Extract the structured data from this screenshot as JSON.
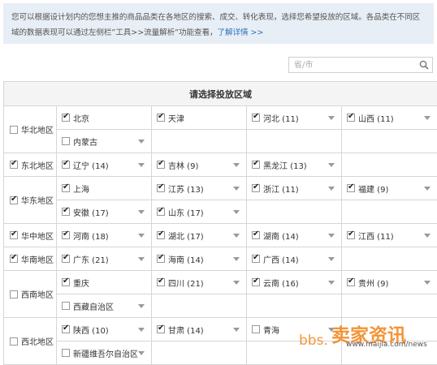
{
  "notice": {
    "text": "您可以根据设计划内的您想主推的商品品类在各地区的搜索、成交、转化表现，选择您希望投放的区域。各品类在不同区域的数据表现可以通过左侧栏”工具>>流量解析”功能查看，",
    "link": "了解详情 >>"
  },
  "search": {
    "placeholder": "省/市",
    "icon": "search-icon"
  },
  "table": {
    "header": "请选择投放区域",
    "regions": [
      {
        "label": "华北地区",
        "checked": false,
        "rows": [
          [
            {
              "label": "北京",
              "checked": true,
              "arrow": false
            },
            {
              "label": "天津",
              "checked": true,
              "arrow": false
            },
            {
              "label": "河北 (11)",
              "checked": true,
              "arrow": true
            },
            {
              "label": "山西 (11)",
              "checked": true,
              "arrow": true
            }
          ],
          [
            {
              "label": "内蒙古",
              "checked": false,
              "arrow": true
            }
          ]
        ]
      },
      {
        "label": "东北地区",
        "checked": true,
        "rows": [
          [
            {
              "label": "辽宁 (14)",
              "checked": true,
              "arrow": true
            },
            {
              "label": "吉林 (9)",
              "checked": true,
              "arrow": true
            },
            {
              "label": "黑龙江 (13)",
              "checked": true,
              "arrow": true
            }
          ]
        ]
      },
      {
        "label": "华东地区",
        "checked": true,
        "rows": [
          [
            {
              "label": "上海",
              "checked": true,
              "arrow": false
            },
            {
              "label": "江苏 (13)",
              "checked": true,
              "arrow": true
            },
            {
              "label": "浙江 (11)",
              "checked": true,
              "arrow": true
            },
            {
              "label": "福建 (9)",
              "checked": true,
              "arrow": true
            }
          ],
          [
            {
              "label": "安徽 (17)",
              "checked": true,
              "arrow": true
            },
            {
              "label": "山东 (17)",
              "checked": true,
              "arrow": true
            }
          ]
        ]
      },
      {
        "label": "华中地区",
        "checked": true,
        "rows": [
          [
            {
              "label": "河南 (18)",
              "checked": true,
              "arrow": true
            },
            {
              "label": "湖北 (17)",
              "checked": true,
              "arrow": true
            },
            {
              "label": "湖南 (14)",
              "checked": true,
              "arrow": true
            },
            {
              "label": "江西 (11)",
              "checked": true,
              "arrow": true
            }
          ]
        ]
      },
      {
        "label": "华南地区",
        "checked": true,
        "rows": [
          [
            {
              "label": "广东 (21)",
              "checked": true,
              "arrow": true
            },
            {
              "label": "海南 (14)",
              "checked": true,
              "arrow": true
            },
            {
              "label": "广西 (14)",
              "checked": true,
              "arrow": true
            }
          ]
        ]
      },
      {
        "label": "西南地区",
        "checked": false,
        "rows": [
          [
            {
              "label": "重庆",
              "checked": true,
              "arrow": false
            },
            {
              "label": "四川 (21)",
              "checked": true,
              "arrow": true
            },
            {
              "label": "云南 (16)",
              "checked": true,
              "arrow": true
            },
            {
              "label": "贵州 (9)",
              "checked": true,
              "arrow": true
            }
          ],
          [
            {
              "label": "西藏自治区",
              "checked": false,
              "arrow": true
            }
          ]
        ]
      },
      {
        "label": "西北地区",
        "checked": false,
        "rows": [
          [
            {
              "label": "陕西 (10)",
              "checked": true,
              "arrow": true
            },
            {
              "label": "甘肃 (14)",
              "checked": true,
              "arrow": true
            },
            {
              "label": "青海",
              "checked": false,
              "arrow": true
            }
          ],
          [
            {
              "label": "新疆维吾尔自治区",
              "checked": false,
              "arrow": true
            }
          ]
        ]
      }
    ]
  },
  "watermark": {
    "big": "卖家资讯",
    "bbs": "bbs.",
    "url": "www.maijia.com/news"
  },
  "colors": {
    "link": "#2a72c4",
    "notice_bg": "#e8eef5",
    "watermark": "#f28c28"
  }
}
